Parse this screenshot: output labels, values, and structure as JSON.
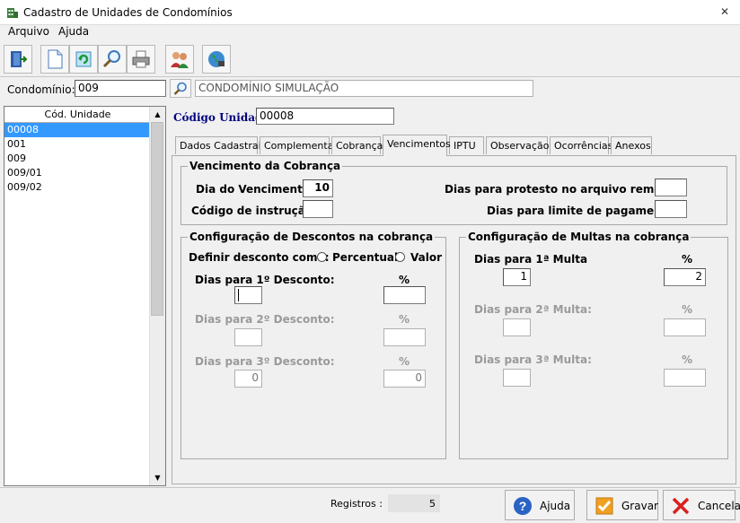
{
  "window": {
    "title": "Cadastro de Unidades de Condomínios",
    "close_glyph": "✕"
  },
  "menu": [
    {
      "label": "Arquivo"
    },
    {
      "label": "Ajuda"
    }
  ],
  "condominio": {
    "label": "Condomínio:",
    "code": "009",
    "name": "CONDOMÍNIO SIMULAÇÃO"
  },
  "list": {
    "header": "Cód. Unidade",
    "items": [
      "00008",
      "001",
      "009",
      "009/01",
      "009/02"
    ],
    "selected_index": 0
  },
  "codigo_unidade": {
    "label": "Código Unidade:",
    "value": "00008"
  },
  "tabs": [
    "Dados Cadastrais",
    "Complementar",
    "Cobrança",
    "Vencimentos",
    "IPTU",
    "Observação",
    "Ocorrências",
    "Anexos"
  ],
  "active_tab": "Vencimentos",
  "vencimento": {
    "title": "Vencimento da  Cobrança",
    "dia_label": "Dia do Vencimento:",
    "dia_value": "10",
    "codigo_instrucao_label": "Código de instrução:",
    "codigo_instrucao_value": "",
    "dias_protesto_label": "Dias para protesto no arquivo remessa:",
    "dias_protesto_value": "",
    "dias_limite_label": "Dias para limite de pagamento:",
    "dias_limite_value": ""
  },
  "descontos": {
    "title": "Configuração de Descontos na cobrança",
    "definir_label": "Definir desconto como:",
    "opt_percentual": "Percentual",
    "opt_valor": "Valor",
    "d1_label": "Dias para 1º Desconto:",
    "d1_value": "",
    "d1_pct_label": "%",
    "d1_pct": "",
    "d2_label": "Dias para 2º Desconto:",
    "d2_value": "",
    "d2_pct_label": "%",
    "d2_pct": "",
    "d3_label": "Dias para 3º Desconto:",
    "d3_value": "0",
    "d3_pct_label": "%",
    "d3_pct": "0"
  },
  "multas": {
    "title": "Configuração de Multas na cobrança",
    "m1_label": "Dias para 1ª Multa",
    "m1_value": "1",
    "m1_pct_label": "%",
    "m1_pct": "2",
    "m2_label": "Dias para 2ª Multa:",
    "m2_value": "",
    "m2_pct_label": "%",
    "m2_pct": "",
    "m3_label": "Dias para 3ª Multa:",
    "m3_value": "",
    "m3_pct_label": "%",
    "m3_pct": ""
  },
  "status": {
    "registros_label": "Registros :",
    "registros_value": "5"
  },
  "buttons": {
    "ajuda": "Ajuda",
    "gravar": "Gravar",
    "cancelar": "Cancelar"
  },
  "colors": {
    "selection": "#3399ff",
    "title_blue": "#000080"
  }
}
